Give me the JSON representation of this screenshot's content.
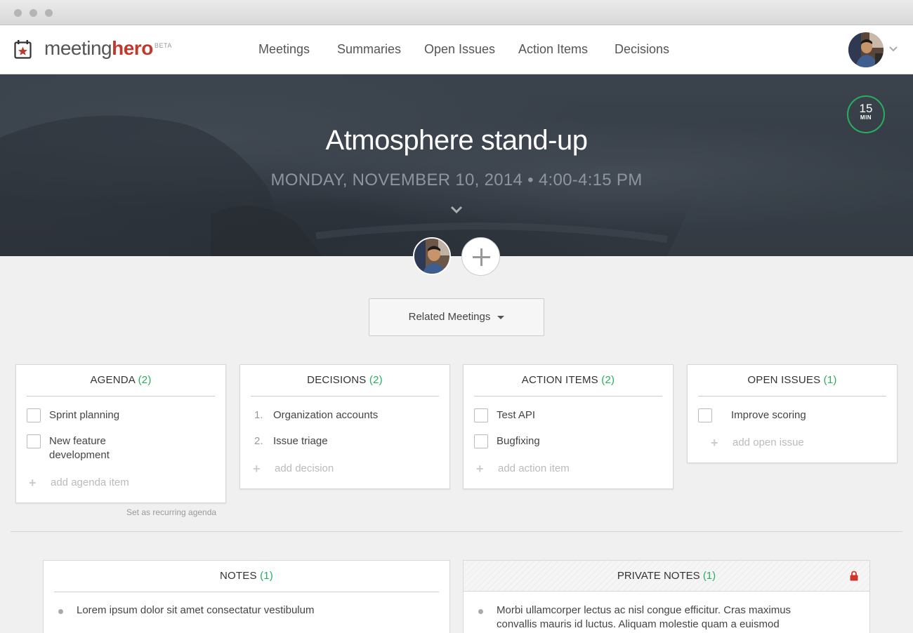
{
  "app": {
    "logo_part1": "meeting",
    "logo_part2": "hero",
    "beta": "BETA"
  },
  "nav": [
    "Meetings",
    "Summaries",
    "Open Issues",
    "Action Items",
    "Decisions"
  ],
  "meeting": {
    "title": "Atmosphere stand-up",
    "datetime": "MONDAY, NOVEMBER 10, 2014 • 4:00-4:15 PM",
    "timer_value": "15",
    "timer_unit": "MIN"
  },
  "related_button": "Related Meetings",
  "agenda": {
    "title": "AGENDA",
    "count": "(2)",
    "items": [
      "Sprint planning",
      "New feature",
      "development"
    ],
    "add_label": "add agenda item",
    "recurring_link": "Set as recurring agenda"
  },
  "decisions": {
    "title": "DECISIONS",
    "count": "(2)",
    "items": [
      {
        "num": "1.",
        "text": "Organization accounts"
      },
      {
        "num": "2.",
        "text": "Issue triage"
      }
    ],
    "add_label": "add decision"
  },
  "action_items": {
    "title": "ACTION ITEMS",
    "count": "(2)",
    "items": [
      "Test API",
      "Bugfixing"
    ],
    "add_label": "add action item"
  },
  "open_issues": {
    "title": "OPEN ISSUES",
    "count": "(1)",
    "items": [
      "Improve scoring"
    ],
    "add_label": "add open issue"
  },
  "notes": {
    "title": "NOTES",
    "count": "(1)",
    "items": [
      "Lorem ipsum dolor sit amet consectatur vestibulum"
    ]
  },
  "private_notes": {
    "title": "PRIVATE NOTES",
    "count": "(1)",
    "lines": [
      "Morbi ullamcorper lectus ac nisl congue efficitur. Cras maximus",
      "convallis mauris id luctus. Aliquam molestie quam a euismod"
    ]
  },
  "colors": {
    "brand_red": "#c0392b",
    "accent_green": "#27ae60"
  }
}
